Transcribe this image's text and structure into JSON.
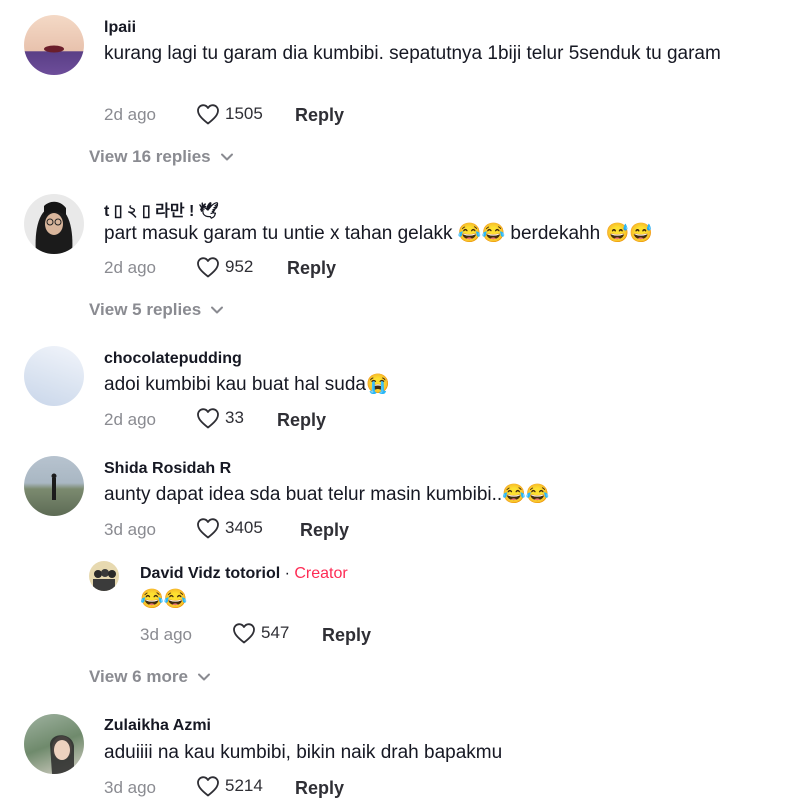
{
  "comments": [
    {
      "username": "lpaii",
      "text": "kurang lagi tu garam dia kumbibi. sepatutnya 1biji telur 5senduk tu garam",
      "time": "2d ago",
      "likes": "1505",
      "reply_label": "Reply",
      "view_replies": "View 16 replies"
    },
    {
      "username": "t ▯ ২ ▯ 라만 ! 🕊",
      "text": "part masuk garam tu untie x tahan gelakk 😂😂 berdekahh 😅😅",
      "time": "2d ago",
      "likes": "952",
      "reply_label": "Reply",
      "view_replies": "View 5 replies"
    },
    {
      "username": "chocolatepudding",
      "text": "adoi kumbibi kau buat hal suda😭",
      "time": "2d ago",
      "likes": "33",
      "reply_label": "Reply"
    },
    {
      "username": "Shida Rosidah R",
      "text": "aunty dapat idea sda buat telur masin kumbibi..😂😂",
      "time": "3d ago",
      "likes": "3405",
      "reply_label": "Reply",
      "reply": {
        "username": "David Vidz totoriol",
        "separator": " · ",
        "badge": "Creator",
        "text": "😂😂",
        "time": "3d ago",
        "likes": "547",
        "reply_label": "Reply"
      },
      "view_more": "View 6 more"
    },
    {
      "username": "Zulaikha Azmi",
      "text": "aduiiii na kau kumbibi, bikin naik drah bapakmu",
      "time": "3d ago",
      "likes": "5214",
      "reply_label": "Reply"
    }
  ],
  "icons": {
    "like": "heart-outline-icon",
    "expand": "chevron-down-icon"
  },
  "colors": {
    "creator_badge": "#fe2c55",
    "meta": "#8a8b91"
  }
}
